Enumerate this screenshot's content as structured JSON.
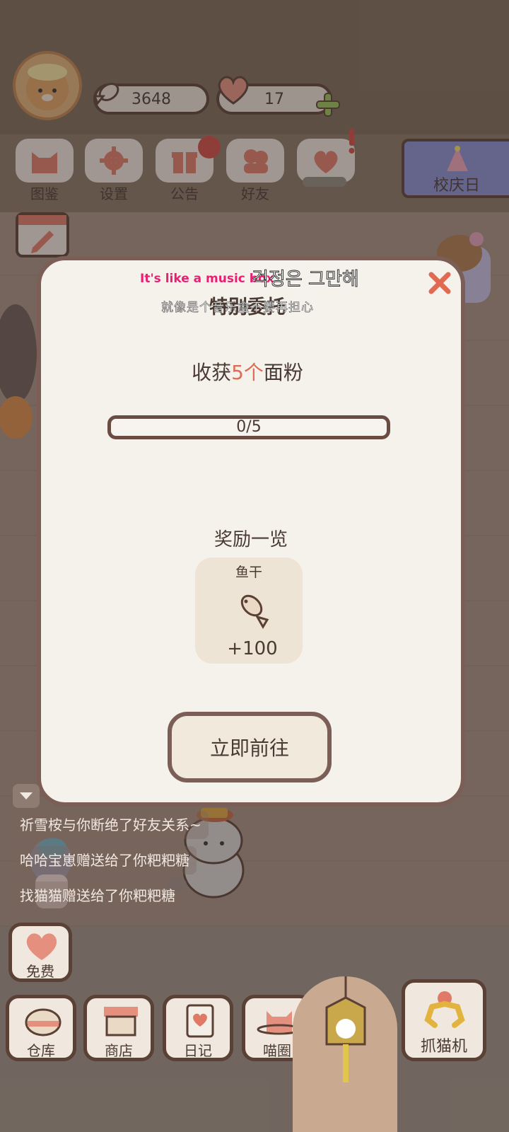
{
  "resources": {
    "fish": "3648",
    "hearts": "17"
  },
  "menu": [
    {
      "label": "图鉴"
    },
    {
      "label": "设置"
    },
    {
      "label": "公告"
    },
    {
      "label": "好友"
    }
  ],
  "banner": {
    "label": "校庆日"
  },
  "dialog": {
    "title": "特别委托",
    "subtitle_en": "It's like a music box",
    "subtitle_kr": "걱정은 그만해",
    "subtitle_zh": "就像是个音乐盒不要再担心",
    "goal_prefix": "收获",
    "goal_count": "5个",
    "goal_item": "面粉",
    "progress_text": "0/5",
    "progress_value": 0,
    "progress_max": 5,
    "reward_title": "奖励一览",
    "reward": {
      "name": "鱼干",
      "amount": "+100"
    },
    "go_button": "立即前往"
  },
  "chat": [
    "祈雪桉与你断绝了好友关系~",
    "哈哈宝崽赠送给了你粑粑糖",
    "找猫猫赠送给了你粑粑糖"
  ],
  "free_button": "免费",
  "bottom": [
    {
      "label": "仓库"
    },
    {
      "label": "商店"
    },
    {
      "label": "日记"
    },
    {
      "label": "喵圈"
    },
    {
      "label": "抓猫机"
    }
  ],
  "colors": {
    "accent": "#e06a52",
    "outline": "#7b5e55",
    "text": "#4a3a33",
    "subtitle_pink": "#e81f73"
  }
}
